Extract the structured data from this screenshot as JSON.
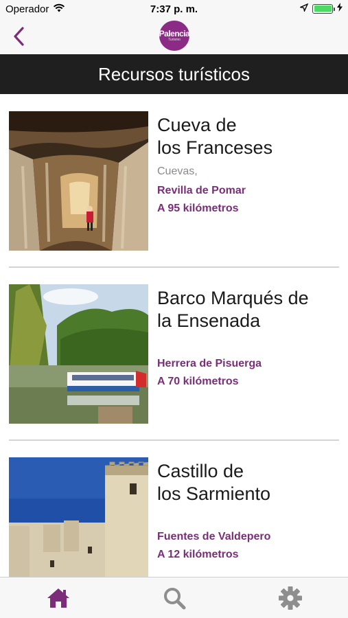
{
  "status_bar": {
    "carrier": "Operador",
    "time": "7:37 p. m.",
    "battery_level": 1.0
  },
  "nav": {
    "back_icon": "chevron-left-icon",
    "logo_text": "Palencia",
    "logo_subtext": "Turismo",
    "accent_color": "#7b2d7a"
  },
  "header": {
    "title": "Recursos turísticos"
  },
  "items": [
    {
      "title": "Cueva de\nlos Franceses",
      "category": "Cuevas,",
      "location": "Revilla de Pomar",
      "distance": "A 95 kilómetros"
    },
    {
      "title": "Barco Marqués de\nla Ensenada",
      "category": "",
      "location": "Herrera de Pisuerga",
      "distance": "A 70 kilómetros"
    },
    {
      "title": "Castillo de\nlos Sarmiento",
      "category": "",
      "location": "Fuentes de Valdepero",
      "distance": "A 12 kilómetros"
    }
  ],
  "tabs": [
    {
      "icon": "home-icon",
      "active": true
    },
    {
      "icon": "search-icon",
      "active": false
    },
    {
      "icon": "gear-icon",
      "active": false
    }
  ]
}
